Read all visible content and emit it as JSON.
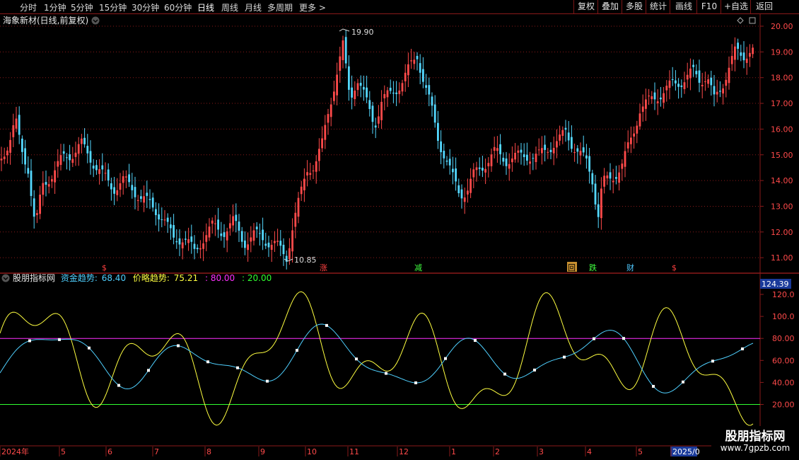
{
  "toolbar": {
    "periods": [
      "分时",
      "1分钟",
      "5分钟",
      "15分钟",
      "30分钟",
      "60分钟",
      "日线",
      "周线",
      "月线",
      "多周期",
      "更多"
    ],
    "active_period": "日线",
    "more_arrow": ">",
    "right_buttons": [
      "复权",
      "叠加",
      "多股",
      "统计",
      "画线",
      "F10",
      "+自选",
      "返回"
    ]
  },
  "main_chart": {
    "title": "海象新材(日线,前复权)",
    "y_ticks": [
      "20.00",
      "19.00",
      "18.00",
      "17.00",
      "16.00",
      "15.00",
      "14.00",
      "13.00",
      "12.00",
      "11.00"
    ],
    "high_label": "19.90",
    "low_label": "10.85",
    "signals": [
      "$",
      "涨",
      "减",
      "回",
      "跌",
      "财",
      "$"
    ],
    "colors": {
      "up": "#ff4a4a",
      "down": "#54d8ff",
      "grid": "#8a1a1a"
    }
  },
  "indicator": {
    "name": "股朋指标网",
    "fund_label": "资金趋势:",
    "fund_value": "68.40",
    "price_label": "价略趋势:",
    "price_value": "75.21",
    "level_high": ": 80.00",
    "level_low": ": 20.00",
    "axis_top": "124.39",
    "y_ticks": [
      "120.0",
      "100.0",
      "80.00",
      "60.00",
      "40.00",
      "20.00"
    ],
    "colors": {
      "fund": "#4fd0ff",
      "price": "#ffff40",
      "high_line": "#ff30ff",
      "low_line": "#30ff30"
    }
  },
  "time_axis": {
    "labels": [
      "2024年",
      "5",
      "6",
      "7",
      "8",
      "9",
      "10",
      "11",
      "12",
      "1",
      "2",
      "3",
      "4",
      "5",
      "2025/0"
    ]
  },
  "watermark": {
    "line1": "股朋指标网",
    "line2": "www.7gpzb.com"
  }
}
